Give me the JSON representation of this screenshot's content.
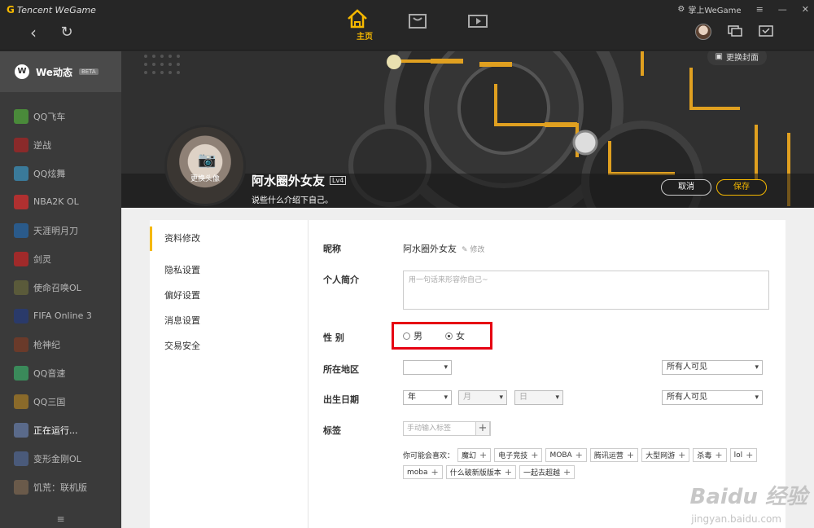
{
  "app": {
    "brand": "Tencent WeGame",
    "user": "掌上WeGame"
  },
  "top_tabs": [
    {
      "name": "home",
      "label": "主页"
    },
    {
      "name": "store",
      "label": ""
    },
    {
      "name": "video",
      "label": ""
    }
  ],
  "sidebar": {
    "header": "We动态",
    "beta": "BETA",
    "items": [
      {
        "label": "QQ飞车",
        "color": "#4a8a3a"
      },
      {
        "label": "逆战",
        "color": "#8a2a2a"
      },
      {
        "label": "QQ炫舞",
        "color": "#3a7a9a"
      },
      {
        "label": "NBA2K OL",
        "color": "#b03030"
      },
      {
        "label": "天涯明月刀",
        "color": "#2a5a8a"
      },
      {
        "label": "剑灵",
        "color": "#a02a2a"
      },
      {
        "label": "使命召唤OL",
        "color": "#5a5a3a"
      },
      {
        "label": "FIFA Online 3",
        "color": "#2a3a6a"
      },
      {
        "label": "枪神纪",
        "color": "#6a3a2a"
      },
      {
        "label": "QQ音速",
        "color": "#3a8a5a"
      },
      {
        "label": "QQ三国",
        "color": "#8a6a2a"
      },
      {
        "label": "正在运行...",
        "color": "#5a6a8a"
      },
      {
        "label": "变形金刚OL",
        "color": "#4a5a7a"
      },
      {
        "label": "饥荒：联机版",
        "color": "#6a5a4a"
      }
    ],
    "footer": "≡"
  },
  "banner": {
    "change_bg": "更换封面",
    "change_avatar": "更换头像",
    "nickname": "阿水圈外女友",
    "level": "Lv4",
    "intro": "说些什么介绍下自己。",
    "cancel": "取消",
    "save": "保存"
  },
  "settings_nav": [
    "资料修改",
    "隐私设置",
    "偏好设置",
    "消息设置",
    "交易安全"
  ],
  "form": {
    "nickname_label": "昵称",
    "nickname_value": "阿水圈外女友",
    "edit": "修改",
    "bio_label": "个人简介",
    "bio_placeholder": "用一句话来形容你自己~",
    "gender_label": "性 别",
    "male": "男",
    "female": "女",
    "region_label": "所在地区",
    "region_value": "",
    "visibility": "所有人可见",
    "birthday_label": "出生日期",
    "year": "年",
    "month": "月",
    "day": "日",
    "tags_label": "标签",
    "tag_placeholder": "手动输入标签",
    "suggest_prefix": "你可能会喜欢：",
    "suggestions": [
      "魔幻",
      "电子竞技",
      "MOBA",
      "腾讯运营",
      "大型网游",
      "杀毒",
      "lol",
      "moba",
      "什么破新版版本",
      "一起去超越"
    ]
  },
  "watermark": {
    "text": "Baidu 经验",
    "url": "jingyan.baidu.com"
  }
}
